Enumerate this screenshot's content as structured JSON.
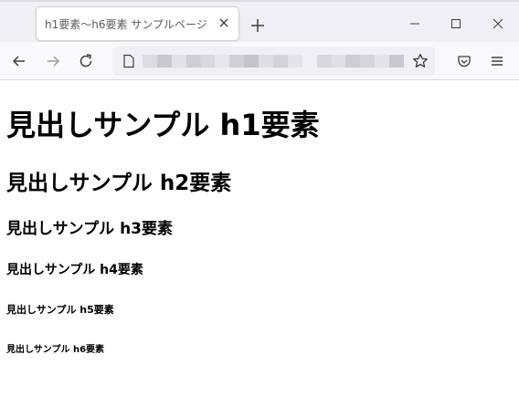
{
  "browser": {
    "tab": {
      "title": "h1要素〜h6要素 サンプルページ"
    },
    "url": {
      "text": ""
    }
  },
  "page": {
    "headings": [
      "見出しサンプル h1要素",
      "見出しサンプル h2要素",
      "見出しサンプル h3要素",
      "見出しサンプル h4要素",
      "見出しサンプル h5要素",
      "見出しサンプル h6要素"
    ]
  },
  "colors": {
    "tabstrip_bg": "#f0f0f4",
    "navbar_bg": "#f9f9fb",
    "icon": "#3c3c45",
    "text": "#000000"
  },
  "icons": [
    "close-icon",
    "plus-icon",
    "minimize-icon",
    "maximize-icon",
    "window-close-icon",
    "back-arrow-icon",
    "forward-arrow-icon",
    "reload-icon",
    "page-icon",
    "bookmark-star-icon",
    "pocket-icon",
    "menu-icon"
  ]
}
